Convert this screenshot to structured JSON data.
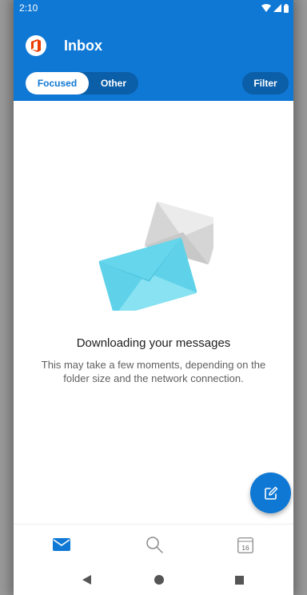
{
  "status_bar": {
    "time": "2:10",
    "icons": [
      "wifi-icon",
      "cellular-icon",
      "battery-icon"
    ]
  },
  "header": {
    "app_icon": "office-icon",
    "title": "Inbox",
    "tabs": [
      {
        "label": "Focused",
        "selected": true
      },
      {
        "label": "Other",
        "selected": false
      }
    ],
    "filter_label": "Filter"
  },
  "empty_state": {
    "illustration": "envelopes-icon",
    "title": "Downloading your messages",
    "message": "This may take a few moments, depending on the folder size and the network connection."
  },
  "fab": {
    "icon": "compose-icon"
  },
  "bottom_nav": {
    "items": [
      {
        "icon": "mail-icon",
        "selected": true
      },
      {
        "icon": "search-icon",
        "selected": false
      },
      {
        "icon": "calendar-icon",
        "selected": false,
        "date": "16"
      }
    ]
  },
  "system_nav": {
    "buttons": [
      "back-icon",
      "home-icon",
      "recents-icon"
    ]
  },
  "colors": {
    "accent": "#0f78d4",
    "pivot_bg": "#0b5ea8",
    "envelope_front": "#62d3ea",
    "envelope_back": "#d9d9d9",
    "office_red": "#eb3c00"
  }
}
